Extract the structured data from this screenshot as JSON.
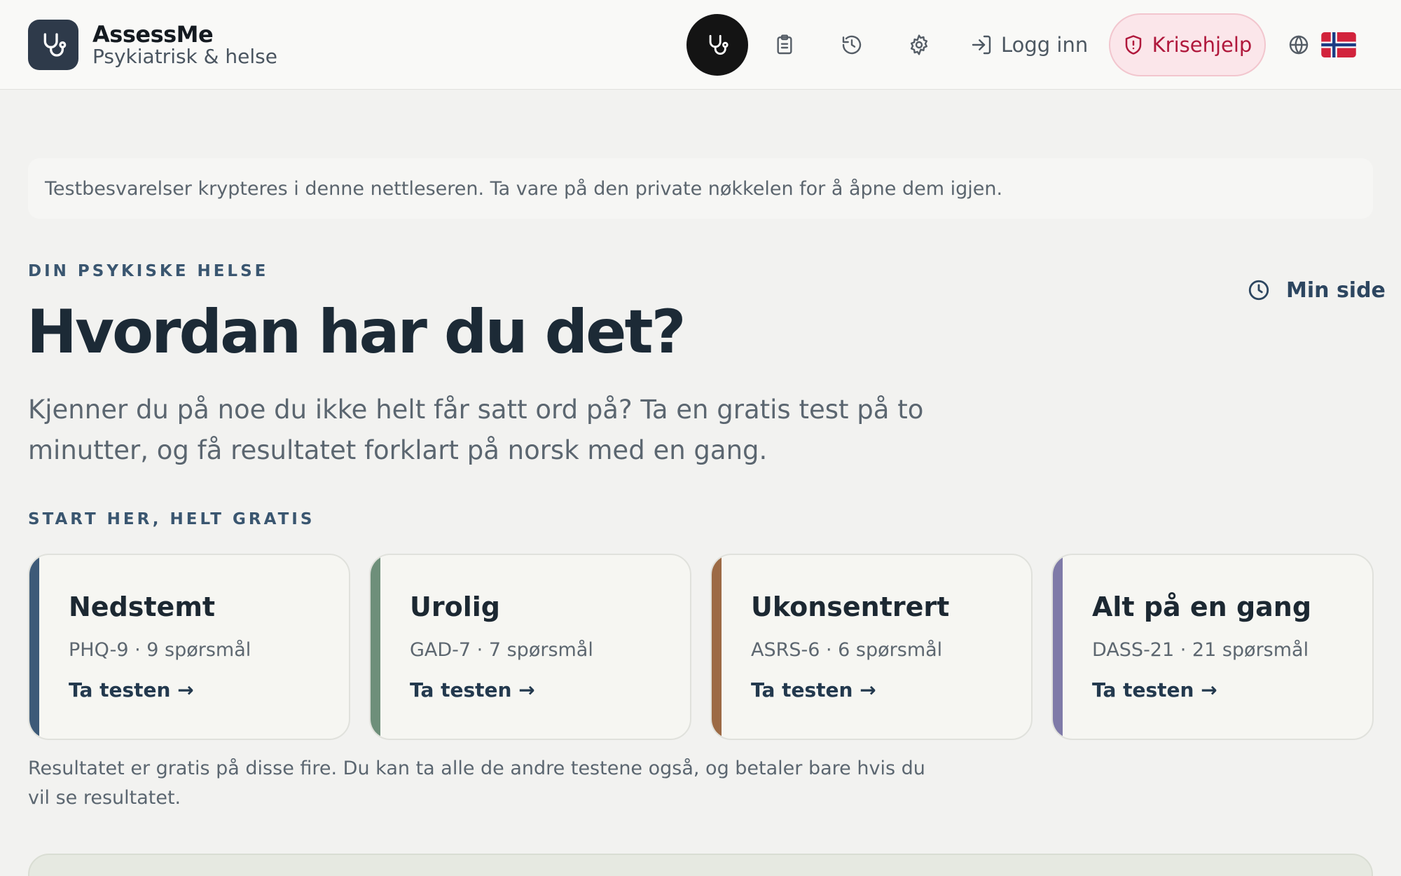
{
  "header": {
    "brand_name": "AssessMe",
    "brand_sub": "Psykiatrisk & helse",
    "nav_icons": [
      "stethoscope-icon",
      "clipboard-icon",
      "history-icon",
      "gear-icon"
    ],
    "login_label": "Logg inn",
    "crisis_label": "Krisehjelp",
    "language_flag": "norway-flag"
  },
  "notice": {
    "text": "Testbesvarelser krypteres i denne nettleseren. Ta vare på den private nøkkelen for å åpne dem igjen."
  },
  "hero": {
    "eyebrow": "DIN PSYKISKE HELSE",
    "minside_label": "Min side",
    "title": "Hvordan har du det?",
    "intro": "Kjenner du på noe du ikke helt får satt ord på? Ta en gratis test på to minutter, og få resultatet forklart på norsk med en gang."
  },
  "tests": {
    "eyebrow": "START HER, HELT GRATIS",
    "cards": [
      {
        "title": "Nedstemt",
        "meta": "PHQ-9 · 9 spørsmål",
        "cta": "Ta testen  →",
        "accent": "#3d5a78"
      },
      {
        "title": "Urolig",
        "meta": "GAD-7 · 7 spørsmål",
        "cta": "Ta testen  →",
        "accent": "#6e8f7a"
      },
      {
        "title": "Ukonsentrert",
        "meta": "ASRS-6 · 6 spørsmål",
        "cta": "Ta testen  →",
        "accent": "#9c6a45"
      },
      {
        "title": "Alt på en gang",
        "meta": "DASS-21 · 21 spørsmål",
        "cta": "Ta testen  →",
        "accent": "#7f7aa8"
      }
    ],
    "footnote": "Resultatet er gratis på disse fire. Du kan ta alle de andre testene også, og betaler bare hvis du vil se resultatet."
  },
  "colors": {
    "background": "#f2f2f0",
    "crisis": "#b0183c",
    "primary_text": "#1c2a36"
  }
}
